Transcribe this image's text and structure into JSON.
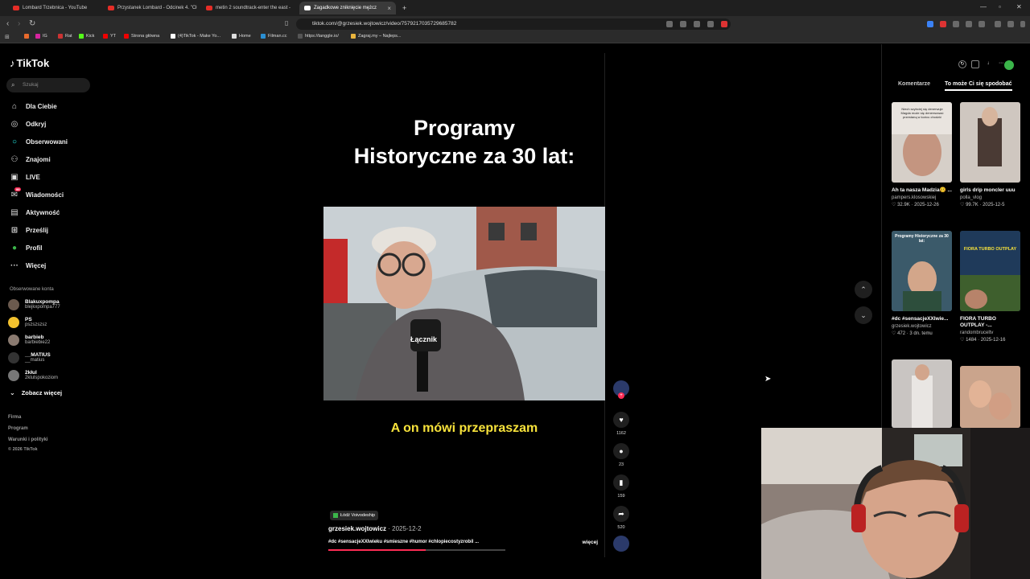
{
  "browser": {
    "tabs": [
      {
        "label": "Lombard Trzebnica - YouTube"
      },
      {
        "label": "Przystanek Lombard - Odcinek 4. \"Cł"
      },
      {
        "label": "metin 2 soundtrack-enter the east -"
      },
      {
        "label": "Zagadkowe zniknięcie mężcz"
      }
    ],
    "url": "tiktok.com/@grzesiek.wojtowicz/video/7579217035729685782",
    "bookmarks": [
      "IG",
      "Rat",
      "Kick",
      "YT",
      "Strona główna",
      "(4)TikTok - Make Yo...",
      "Home",
      "Filman.cc",
      "https://tanggle.io/",
      "Zagraj.my – Najleps..."
    ]
  },
  "tiktok": {
    "logo": "TikTok",
    "search_placeholder": "Szukaj",
    "nav": [
      "Dla Ciebie",
      "Odkryj",
      "Obserwowani",
      "Znajomi",
      "LIVE",
      "Wiadomości",
      "Aktywność",
      "Prześlij",
      "Profil",
      "Więcej"
    ],
    "messages_badge": "99",
    "followed_title": "Obserwowane konta",
    "followed": [
      {
        "name": "Blakuxpompa",
        "user": "blejkxpompa777"
      },
      {
        "name": "PS",
        "user": "pszszszsz"
      },
      {
        "name": "barbieb",
        "user": "barbiebie22"
      },
      {
        "name": "__MATIUS",
        "user": "__matius"
      },
      {
        "name": "2kłul",
        "user": "2klulspokoziom"
      }
    ],
    "see_more": "Zobacz więcej",
    "footer": [
      "Firma",
      "Program",
      "Warunki i polityki",
      "© 2026 TikTok"
    ]
  },
  "video": {
    "title_line1": "Programy",
    "title_line2": "Historyczne za 30 lat:",
    "caption": "A on mówi przepraszam",
    "mic_label": "Łącznik",
    "location": "Łódź Voivodeship",
    "author": "grzesiek.wojtowicz",
    "date": "· 2025-12-2",
    "tags": "#dc #sensacjeXXIwieku #smieszne #humor #chlopiecostyzrobil ...",
    "more": "więcej",
    "progress": 0.55,
    "likes": "1162",
    "comments": "23",
    "saves": "159",
    "shares": "520"
  },
  "panel": {
    "tab_comments": "Komentarze",
    "tab_recommend": "To może Ci się spodobać",
    "cards": [
      {
        "title": "Ah ta nasza Madzia🥴 ...",
        "user": "pampers.klosowskiej",
        "likes": "32.9K",
        "date": "2025-12-26",
        "thumb_text": "Niech szybciej się denerwuje Magda może się denerwować przestaną w końcu chodzić",
        "color": "#c9b7a6"
      },
      {
        "title": "girls drip moncler uuu",
        "user": "polla_vlog",
        "likes": "99.7K",
        "date": "2025-12-5",
        "thumb_text": "",
        "color": "#a89a90"
      },
      {
        "title": "#dc #sensacjeXXIwie...",
        "user": "grzesiek.wojtowicz",
        "likes": "472",
        "date": "3 dn. temu",
        "thumb_text": "Programy Historyczne za 30 lat:",
        "color": "#3b5a6a"
      },
      {
        "title": "FIORA TURBO OUTPLAY -...",
        "user": "randombruceltv",
        "likes": "1484",
        "date": "2025-12-16",
        "thumb_text": "FIORA TURBO OUTPLAY",
        "color": "#2a4a7a"
      },
      {
        "title": "",
        "user": "",
        "likes": "",
        "date": "",
        "thumb_text": "",
        "color": "#8f8a85"
      },
      {
        "title": "",
        "user": "",
        "likes": "",
        "date": "",
        "thumb_text": "",
        "color": "#b88a70"
      }
    ]
  },
  "colors": {
    "accent": "#fe2c55",
    "caption": "#f7e23b",
    "bg": "#000000"
  }
}
